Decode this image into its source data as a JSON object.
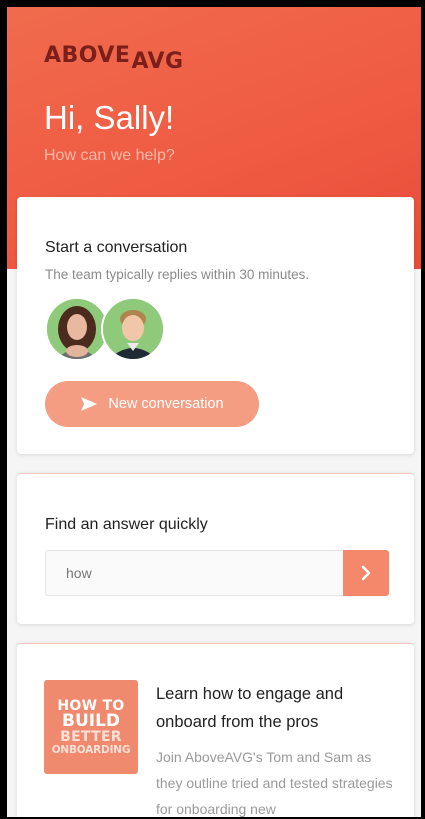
{
  "brand": {
    "logo_main": "ABOVE",
    "logo_sub": "AVG"
  },
  "header": {
    "greeting": "Hi, Sally!",
    "subtitle": "How can we help?"
  },
  "conversation": {
    "title": "Start a conversation",
    "subtitle": "The team typically replies within 30 minutes.",
    "button_label": "New conversation",
    "button_icon": "send-icon"
  },
  "search": {
    "title": "Find an answer quickly",
    "value": "how",
    "button_icon": "chevron-right-icon"
  },
  "article": {
    "thumb_lines": [
      "HOW TO",
      "BUILD",
      "BETTER",
      "ONBOARDING"
    ],
    "title": "Learn how to engage and onboard from the pros",
    "body": "Join AboveAVG's Tom and Sam as they outline tried and tested strategies for onboarding new"
  },
  "colors": {
    "accent": "#ef5b43",
    "button": "#f59d83",
    "logo": "#7a1f1a"
  }
}
